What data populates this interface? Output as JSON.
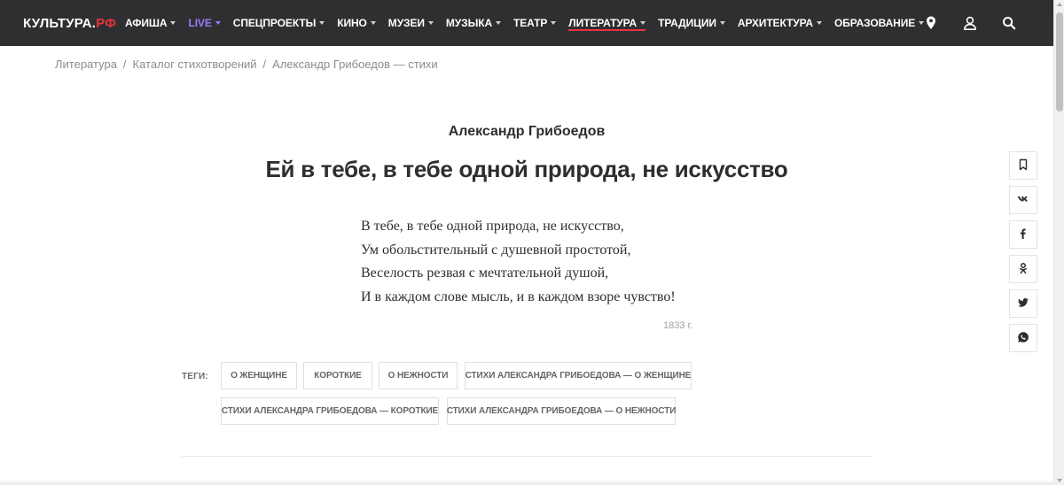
{
  "header": {
    "logo_main": "КУЛЬТУРА.",
    "logo_accent": "РФ",
    "nav": [
      {
        "label": "АФИША"
      },
      {
        "label": "LIVE"
      },
      {
        "label": "СПЕЦПРОЕКТЫ"
      },
      {
        "label": "КИНО"
      },
      {
        "label": "МУЗЕИ"
      },
      {
        "label": "МУЗЫКА"
      },
      {
        "label": "ТЕАТР"
      },
      {
        "label": "ЛИТЕРАТУРА"
      },
      {
        "label": "ТРАДИЦИИ"
      },
      {
        "label": "АРХИТЕКТУРА"
      },
      {
        "label": "ОБРАЗОВАНИЕ"
      }
    ],
    "icons": [
      "location-pin-icon",
      "user-icon",
      "search-icon"
    ]
  },
  "breadcrumb": {
    "items": [
      "Литература",
      "Каталог стихотворений",
      "Александр Грибоедов — стихи"
    ],
    "separator": "/"
  },
  "poem": {
    "author": "Александр Грибоедов",
    "title": "Ей в тебе, в тебе одной природа, не искусство",
    "lines": [
      "В тебе, в тебе одной природа, не искусство,",
      "Ум обольстительный с душевной простотой,",
      "Веселость резвая с мечтательной душой,",
      "И в каждом слове мысль, и в каждом взоре чувство!"
    ],
    "year": "1833 г."
  },
  "tags": {
    "label": "ТЕГИ:",
    "items": [
      "О ЖЕНЩИНЕ",
      "КОРОТКИЕ",
      "О НЕЖНОСТИ",
      "СТИХИ АЛЕКСАНДРА ГРИБОЕДОВА — О ЖЕНЩИНЕ",
      "СТИХИ АЛЕКСАНДРА ГРИБОЕДОВА — КОРОТКИЕ",
      "СТИХИ АЛЕКСАНДРА ГРИБОЕДОВА — О НЕЖНОСТИ"
    ]
  },
  "share": {
    "buttons": [
      {
        "icon": "bookmark-icon"
      },
      {
        "icon": "vk-icon"
      },
      {
        "icon": "facebook-icon"
      },
      {
        "icon": "odnoklassniki-icon"
      },
      {
        "icon": "twitter-icon"
      },
      {
        "icon": "whatsapp-icon"
      }
    ]
  },
  "colors": {
    "header_bg": "#2f2f31",
    "accent": "#e8323c",
    "live": "#9b7cff"
  }
}
